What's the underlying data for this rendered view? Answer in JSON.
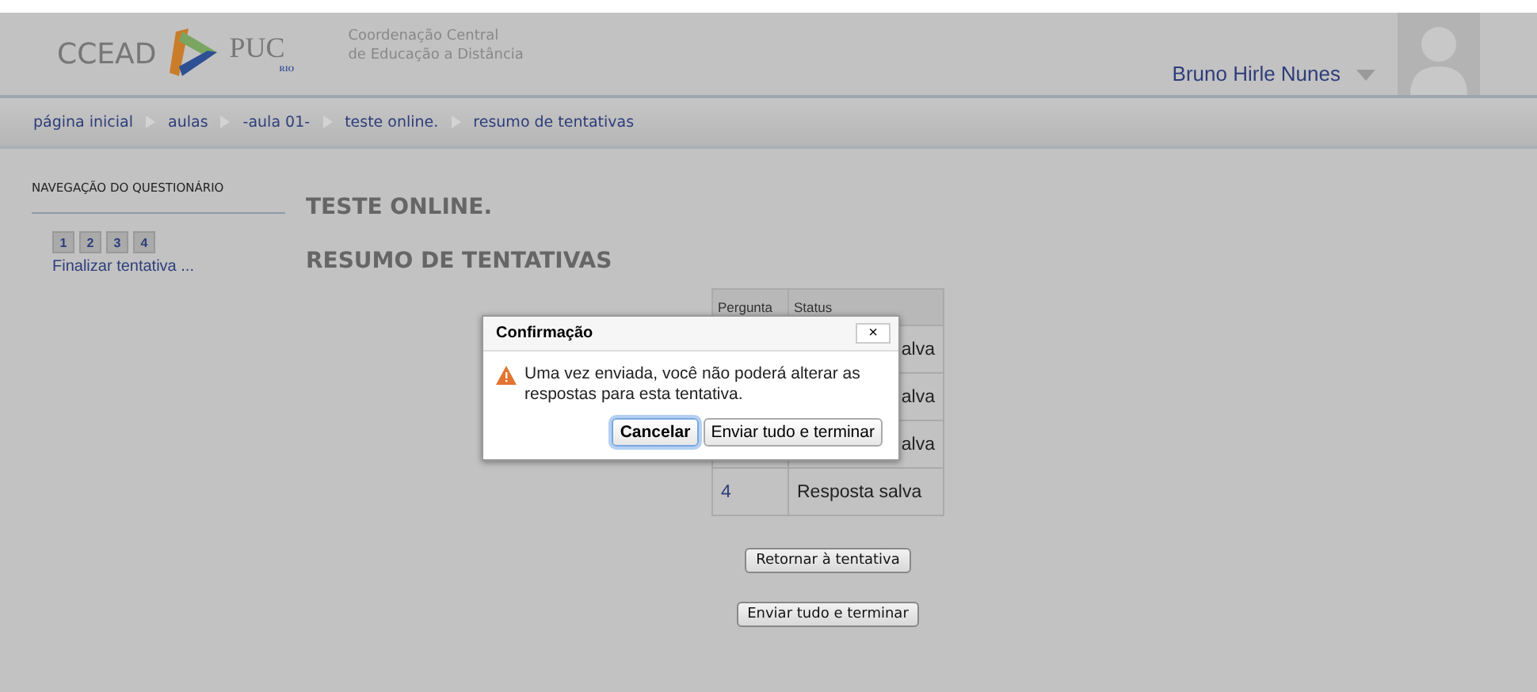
{
  "header": {
    "logo_text": "CCEAD",
    "logo_text_2": "PUC",
    "logo_sub": "RIO",
    "org_line_1": "Coordenação Central",
    "org_line_2": "de Educação a Distância",
    "user_name": "Bruno Hirle Nunes"
  },
  "breadcrumb": [
    "página inicial",
    "aulas",
    "-aula 01-",
    "teste online.",
    "resumo de tentativas"
  ],
  "sidebar": {
    "title": "NAVEGAÇÃO DO QUESTIONÁRIO",
    "questions": [
      "1",
      "2",
      "3",
      "4"
    ],
    "finish_link": "Finalizar tentativa ..."
  },
  "content": {
    "title": "TESTE ONLINE.",
    "subtitle": "RESUMO DE TENTATIVAS"
  },
  "table": {
    "columns": [
      "Pergunta",
      "Status"
    ],
    "rows": [
      {
        "status": "alva"
      },
      {
        "status": "alva"
      },
      {
        "status": "alva"
      },
      {
        "question": "4",
        "status": "Resposta salva"
      }
    ]
  },
  "buttons": [
    "Retornar à tentativa",
    "Enviar tudo e terminar"
  ],
  "dialog": {
    "title": "Confirmação",
    "close": "×",
    "message": "Uma vez enviada, você não poderá alterar as respostas para esta tentativa.",
    "buttons": [
      {
        "label": "Cancelar",
        "selected": true
      },
      {
        "label": "Enviar tudo e terminar",
        "selected": false
      }
    ]
  }
}
